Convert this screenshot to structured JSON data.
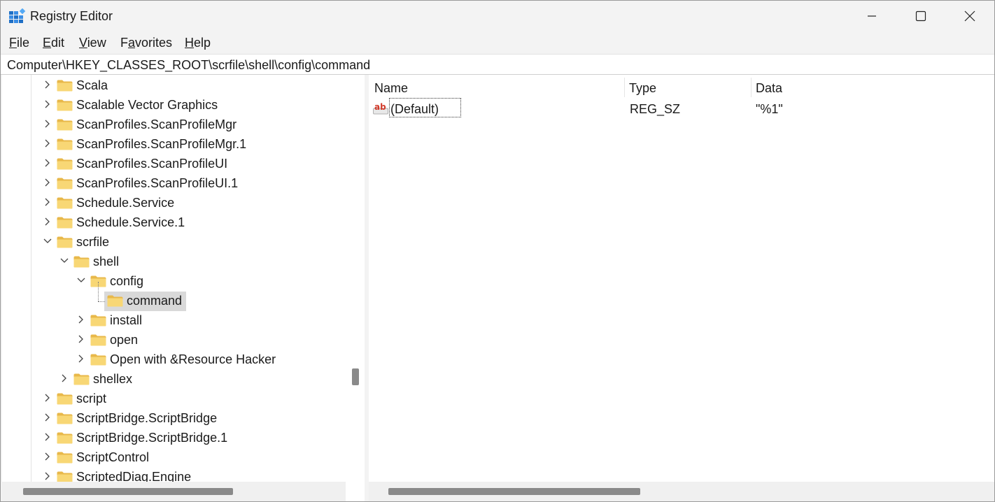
{
  "window": {
    "title": "Registry Editor",
    "icon": "registry-editor-icon",
    "controls": [
      "minimize-icon",
      "maximize-icon",
      "close-icon"
    ]
  },
  "menu": {
    "file": {
      "key": "F",
      "rest": "ile"
    },
    "edit": {
      "key": "E",
      "rest": "dit"
    },
    "view": {
      "key": "V",
      "rest": "iew"
    },
    "favorites": {
      "pre": "F",
      "key": "a",
      "rest": "vorites"
    },
    "help": {
      "key": "H",
      "rest": "elp"
    }
  },
  "address": "Computer\\HKEY_CLASSES_ROOT\\scrfile\\shell\\config\\command",
  "tree": {
    "items": [
      {
        "label": "Scala",
        "expanded": false
      },
      {
        "label": "Scalable Vector Graphics",
        "expanded": false
      },
      {
        "label": "ScanProfiles.ScanProfileMgr",
        "expanded": false
      },
      {
        "label": "ScanProfiles.ScanProfileMgr.1",
        "expanded": false
      },
      {
        "label": "ScanProfiles.ScanProfileUI",
        "expanded": false
      },
      {
        "label": "ScanProfiles.ScanProfileUI.1",
        "expanded": false
      },
      {
        "label": "Schedule.Service",
        "expanded": false
      },
      {
        "label": "Schedule.Service.1",
        "expanded": false
      },
      {
        "label": "scrfile",
        "expanded": true
      },
      {
        "label": "shell",
        "expanded": true
      },
      {
        "label": "config",
        "expanded": true
      },
      {
        "label": "command",
        "selected": true
      },
      {
        "label": "install",
        "expanded": false
      },
      {
        "label": "open",
        "expanded": false
      },
      {
        "label": "Open with &Resource Hacker",
        "expanded": false
      },
      {
        "label": "shellex",
        "expanded": false
      },
      {
        "label": "script",
        "expanded": false
      },
      {
        "label": "ScriptBridge.ScriptBridge",
        "expanded": false
      },
      {
        "label": "ScriptBridge.ScriptBridge.1",
        "expanded": false
      },
      {
        "label": "ScriptControl",
        "expanded": false
      },
      {
        "label": "ScriptedDiag.Engine",
        "expanded": false
      }
    ]
  },
  "list": {
    "headers": {
      "name": "Name",
      "type": "Type",
      "data": "Data"
    },
    "rows": [
      {
        "icon": "string-value-icon",
        "name": "(Default)",
        "type": "REG_SZ",
        "data": "\"%1\""
      }
    ]
  },
  "colors": {
    "folder": "#f8d775",
    "selection": "#d9d9d9",
    "accent": "#0078d4"
  }
}
